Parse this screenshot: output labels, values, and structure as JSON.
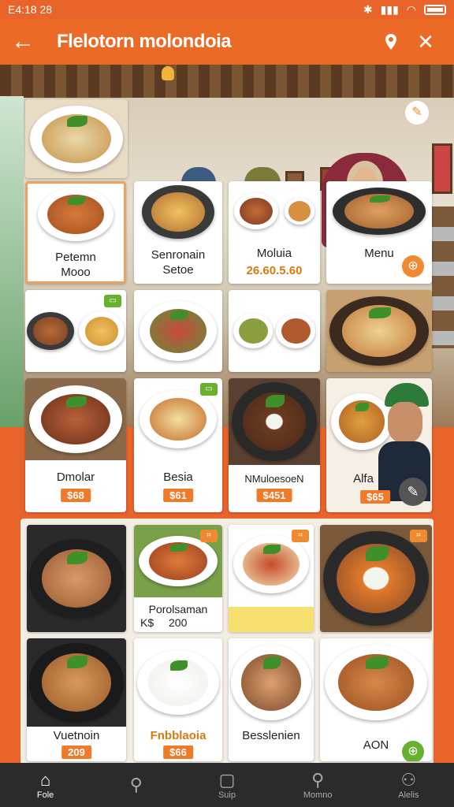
{
  "status_bar": {
    "time": "E4:18 28"
  },
  "header": {
    "title": "Flelotorn molondoia",
    "back_icon": "back-arrow-icon",
    "action_icon": "location-pin-icon",
    "close_icon": "close-icon"
  },
  "colors": {
    "accent": "#ea6a26",
    "price_bg": "#f07a28",
    "badge_green": "#68b030",
    "nav_bg": "#2b2b2b"
  },
  "grid_row1": [
    {
      "label": "Petemn\nMooo"
    },
    {
      "label": "Senronain\nSetoe"
    },
    {
      "label": "Moluia",
      "price": "26.60.5.60"
    },
    {
      "label": "Menu"
    }
  ],
  "grid_row3": [
    {
      "label": "Dmolar",
      "price": "$68"
    },
    {
      "label": "Besia",
      "price": "$61"
    },
    {
      "label": "NMuloesoeN",
      "price": "$451"
    },
    {
      "label": "Alfa",
      "price": "$65"
    }
  ],
  "grid_section2": [
    {
      "label": "Porolsaman",
      "sub": "K$",
      "price": "200"
    },
    {
      "label": "Vuetnoin",
      "price": "209"
    },
    {
      "label": "Fnbblaoia",
      "price": "$66"
    },
    {
      "label": "Besslenien"
    },
    {
      "label": "AON"
    }
  ],
  "bottom_nav": [
    {
      "label": "Fole",
      "icon": "home-icon",
      "active": true
    },
    {
      "label": "",
      "icon": "search-icon",
      "active": false
    },
    {
      "label": "Suip",
      "icon": "square-icon",
      "active": false
    },
    {
      "label": "Momno",
      "icon": "search-icon",
      "active": false
    },
    {
      "label": "Alelis",
      "icon": "user-icon",
      "active": false
    }
  ]
}
